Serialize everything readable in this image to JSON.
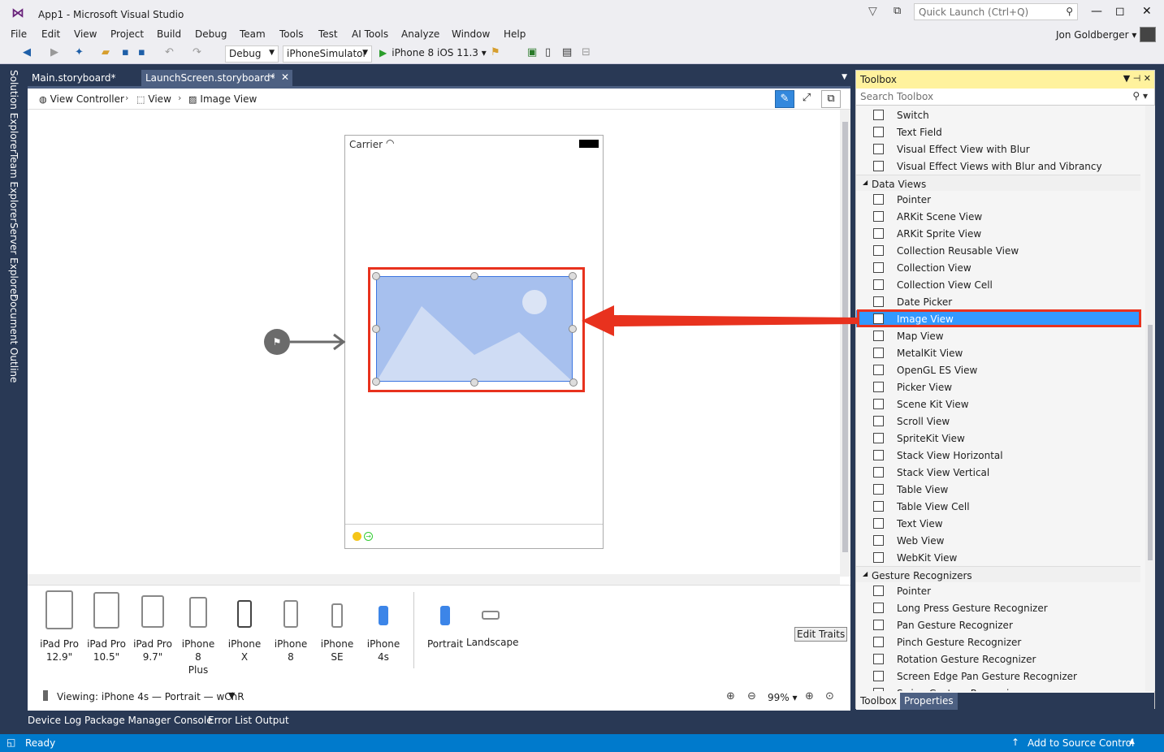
{
  "window": {
    "title": "App1 - Microsoft Visual Studio",
    "quick_launch_placeholder": "Quick Launch (Ctrl+Q)",
    "account_name": "Jon Goldberger"
  },
  "menu": [
    "File",
    "Edit",
    "View",
    "Project",
    "Build",
    "Debug",
    "Team",
    "Tools",
    "Test",
    "AI Tools",
    "Analyze",
    "Window",
    "Help"
  ],
  "toolbar": {
    "configuration": "Debug",
    "platform": "iPhoneSimulator",
    "run_target": "iPhone 8 iOS 11.3"
  },
  "left_tabs": [
    "Solution Explorer",
    "Team Explorer",
    "Server Explorer",
    "Document Outline"
  ],
  "doc_tabs": [
    {
      "label": "Main.storyboard*"
    },
    {
      "label": "LaunchScreen.storyboard*"
    }
  ],
  "breadcrumb": [
    "View Controller",
    "View",
    "Image View"
  ],
  "phone": {
    "carrier": "Carrier"
  },
  "devices": [
    {
      "label": "iPad Pro\n12.9\""
    },
    {
      "label": "iPad Pro\n10.5\""
    },
    {
      "label": "iPad Pro\n9.7\""
    },
    {
      "label": "iPhone 8\nPlus"
    },
    {
      "label": "iPhone X"
    },
    {
      "label": "iPhone 8"
    },
    {
      "label": "iPhone SE"
    },
    {
      "label": "iPhone 4s"
    }
  ],
  "orientations": [
    {
      "label": "Portrait"
    },
    {
      "label": "Landscape"
    }
  ],
  "edit_traits_label": "Edit Traits",
  "viewing_text": "Viewing: iPhone 4s — Portrait — wChR",
  "zoom_level": "99%",
  "toolbox": {
    "title": "Toolbox",
    "search_placeholder": "Search Toolbox",
    "items_top": [
      "Switch",
      "Text Field",
      "Visual Effect View with Blur",
      "Visual Effect Views with Blur and Vibrancy"
    ],
    "category_data_views": "Data Views",
    "data_views": [
      "Pointer",
      "ARKit Scene View",
      "ARKit Sprite View",
      "Collection Reusable View",
      "Collection View",
      "Collection View Cell",
      "Date Picker",
      "Image View",
      "Map View",
      "MetalKit View",
      "OpenGL ES View",
      "Picker View",
      "Scene Kit View",
      "Scroll View",
      "SpriteKit View",
      "Stack View Horizontal",
      "Stack View Vertical",
      "Table View",
      "Table View Cell",
      "Text View",
      "Web View",
      "WebKit View"
    ],
    "selected_item": "Image View",
    "category_gestures": "Gesture Recognizers",
    "gestures": [
      "Pointer",
      "Long Press Gesture Recognizer",
      "Pan Gesture Recognizer",
      "Pinch Gesture Recognizer",
      "Rotation Gesture Recognizer",
      "Screen Edge Pan Gesture Recognizer",
      "Swipe Gesture Recognizer"
    ],
    "tabs": [
      "Toolbox",
      "Properties"
    ]
  },
  "bottom_tabs": [
    "Device Log",
    "Package Manager Console",
    "Error List",
    "Output"
  ],
  "status": {
    "ready": "Ready",
    "source_control": "Add to Source Control"
  },
  "colors": {
    "accent": "#007acc",
    "highlight": "#e8321e",
    "selection": "#3399ff",
    "frame": "#293955"
  }
}
